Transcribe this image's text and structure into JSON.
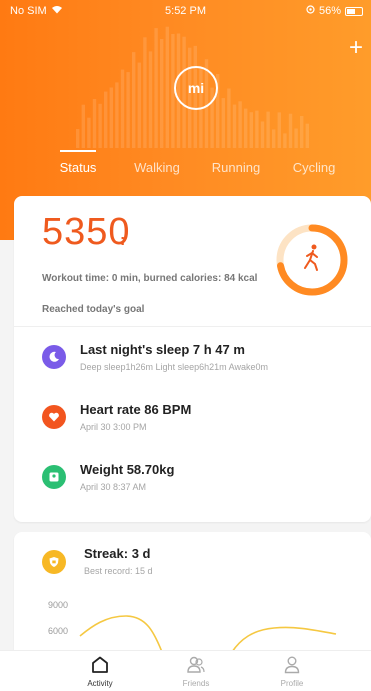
{
  "status_bar": {
    "carrier": "No SIM",
    "time": "5:52 PM",
    "battery": "56%"
  },
  "header": {
    "logo_text": "mi",
    "tabs": [
      {
        "label": "Status",
        "active": true
      },
      {
        "label": "Walking",
        "active": false
      },
      {
        "label": "Running",
        "active": false
      },
      {
        "label": "Cycling",
        "active": false
      }
    ]
  },
  "summary": {
    "steps": "5350",
    "steps_suffix": ":",
    "workout_text": "Workout time: 0 min, burned calories: 84 kcal",
    "goal_text": "Reached today's goal",
    "goal_progress": 0.72,
    "ring_icon": "walking-person-icon"
  },
  "metrics": [
    {
      "icon": "moon-icon",
      "color": "#7a5be8",
      "title": "Last night's sleep 7 h 47 m",
      "subtitle": "Deep sleep1h26m Light sleep6h21m Awake0m"
    },
    {
      "icon": "heart-icon",
      "color": "#f2551f",
      "title": "Heart rate 86 BPM",
      "subtitle": "April 30 3:00 PM"
    },
    {
      "icon": "scale-icon",
      "color": "#2bbf73",
      "title": "Weight 58.70kg",
      "subtitle": "April 30 8:37 AM"
    }
  ],
  "streak": {
    "icon": "shield-icon",
    "title": "Streak: 3 d",
    "subtitle": "Best record: 15 d",
    "y_ticks": [
      "9000",
      "6000"
    ]
  },
  "bottom_nav": [
    {
      "label": "Activity",
      "icon": "home-icon",
      "active": true
    },
    {
      "label": "Friends",
      "icon": "friends-icon",
      "active": false
    },
    {
      "label": "Profile",
      "icon": "profile-icon",
      "active": false
    }
  ],
  "colors": {
    "accent": "#ff7a12",
    "steps": "#ef5a1e",
    "streak": "#f7b825"
  }
}
